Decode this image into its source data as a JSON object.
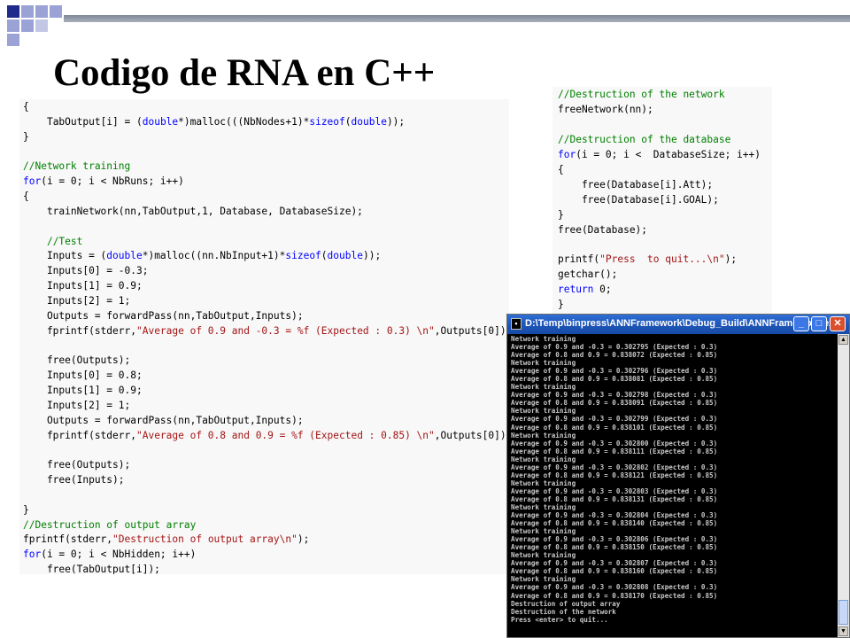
{
  "slide": {
    "title": "Codigo de RNA en C++",
    "accent_colors": [
      "#1f2b8c",
      "#9aa2d6"
    ]
  },
  "code_left": {
    "lines": [
      [
        {
          "t": "{"
        }
      ],
      [
        {
          "t": "    "
        },
        {
          "t": "TabOutput[i] = ("
        },
        {
          "t": "double",
          "c": "ty"
        },
        {
          "t": "*)malloc(((NbNodes+1)*"
        },
        {
          "t": "sizeof",
          "c": "kw"
        },
        {
          "t": "("
        },
        {
          "t": "double",
          "c": "ty"
        },
        {
          "t": "));"
        }
      ],
      [
        {
          "t": "}"
        }
      ],
      [
        {
          "t": ""
        }
      ],
      [
        {
          "t": "//Network training",
          "c": "cm"
        }
      ],
      [
        {
          "t": "for",
          "c": "kw"
        },
        {
          "t": "(i = 0; i < NbRuns; i++)"
        }
      ],
      [
        {
          "t": "{"
        }
      ],
      [
        {
          "t": "    trainNetwork(nn,TabOutput,1, Database, DatabaseSize);"
        }
      ],
      [
        {
          "t": ""
        }
      ],
      [
        {
          "t": "    "
        },
        {
          "t": "//Test",
          "c": "cm"
        }
      ],
      [
        {
          "t": "    Inputs = ("
        },
        {
          "t": "double",
          "c": "ty"
        },
        {
          "t": "*)malloc((nn.NbInput+1)*"
        },
        {
          "t": "sizeof",
          "c": "kw"
        },
        {
          "t": "("
        },
        {
          "t": "double",
          "c": "ty"
        },
        {
          "t": "));"
        }
      ],
      [
        {
          "t": "    Inputs[0] = -0.3;"
        }
      ],
      [
        {
          "t": "    Inputs[1] = 0.9;"
        }
      ],
      [
        {
          "t": "    Inputs[2] = 1;"
        }
      ],
      [
        {
          "t": "    Outputs = forwardPass(nn,TabOutput,Inputs);"
        }
      ],
      [
        {
          "t": "    fprintf(stderr,"
        },
        {
          "t": "\"Average of 0.9 and -0.3 = %f (Expected : 0.3) \\n\"",
          "c": "st"
        },
        {
          "t": ",Outputs[0]);"
        }
      ],
      [
        {
          "t": ""
        }
      ],
      [
        {
          "t": "    free(Outputs);"
        }
      ],
      [
        {
          "t": "    Inputs[0] = 0.8;"
        }
      ],
      [
        {
          "t": "    Inputs[1] = 0.9;"
        }
      ],
      [
        {
          "t": "    Inputs[2] = 1;"
        }
      ],
      [
        {
          "t": "    Outputs = forwardPass(nn,TabOutput,Inputs);"
        }
      ],
      [
        {
          "t": "    fprintf(stderr,"
        },
        {
          "t": "\"Average of 0.8 and 0.9 = %f (Expected : 0.85) \\n\"",
          "c": "st"
        },
        {
          "t": ",Outputs[0]);"
        }
      ],
      [
        {
          "t": ""
        }
      ],
      [
        {
          "t": "    free(Outputs);"
        }
      ],
      [
        {
          "t": "    free(Inputs);"
        }
      ],
      [
        {
          "t": ""
        }
      ],
      [
        {
          "t": "}"
        }
      ],
      [
        {
          "t": "//Destruction of output array",
          "c": "cm"
        }
      ],
      [
        {
          "t": "fprintf(stderr,"
        },
        {
          "t": "\"Destruction of output array\\n\"",
          "c": "st"
        },
        {
          "t": ");"
        }
      ],
      [
        {
          "t": "for",
          "c": "kw"
        },
        {
          "t": "(i = 0; i < NbHidden; i++)"
        }
      ],
      [
        {
          "t": "    free(TabOutput[i]);"
        }
      ]
    ]
  },
  "code_right": {
    "lines": [
      [
        {
          "t": "//Destruction of the network",
          "c": "cm"
        }
      ],
      [
        {
          "t": "freeNetwork(nn);"
        }
      ],
      [
        {
          "t": ""
        }
      ],
      [
        {
          "t": "//Destruction of the database",
          "c": "cm"
        }
      ],
      [
        {
          "t": "for",
          "c": "kw"
        },
        {
          "t": "(i = 0; i <  DatabaseSize; i++)"
        }
      ],
      [
        {
          "t": "{"
        }
      ],
      [
        {
          "t": "    free(Database[i].Att);"
        }
      ],
      [
        {
          "t": "    free(Database[i].GOAL);"
        }
      ],
      [
        {
          "t": "}"
        }
      ],
      [
        {
          "t": "free(Database);"
        }
      ],
      [
        {
          "t": ""
        }
      ],
      [
        {
          "t": "printf("
        },
        {
          "t": "\"Press  to quit...\\n\"",
          "c": "st"
        },
        {
          "t": ");"
        }
      ],
      [
        {
          "t": "getchar();"
        }
      ],
      [
        {
          "t": "return",
          "c": "kw"
        },
        {
          "t": " 0;"
        }
      ],
      [
        {
          "t": "}"
        }
      ]
    ]
  },
  "console": {
    "window_title": "D:\\Temp\\binpress\\ANNFramework\\Debug_Build\\ANNFramework.exe",
    "icon": "console-app-icon",
    "minimize_label": "_",
    "maximize_label": "□",
    "close_label": "✕",
    "lines": [
      "Network training",
      "Average of 0.9 and -0.3 = 0.302795 (Expected : 0.3)",
      "Average of 0.8 and 0.9 = 0.838072 (Expected : 0.85)",
      "Network training",
      "Average of 0.9 and -0.3 = 0.302796 (Expected : 0.3)",
      "Average of 0.8 and 0.9 = 0.838081 (Expected : 0.85)",
      "Network training",
      "Average of 0.9 and -0.3 = 0.302798 (Expected : 0.3)",
      "Average of 0.8 and 0.9 = 0.838091 (Expected : 0.85)",
      "Network training",
      "Average of 0.9 and -0.3 = 0.302799 (Expected : 0.3)",
      "Average of 0.8 and 0.9 = 0.838101 (Expected : 0.85)",
      "Network training",
      "Average of 0.9 and -0.3 = 0.302800 (Expected : 0.3)",
      "Average of 0.8 and 0.9 = 0.838111 (Expected : 0.85)",
      "Network training",
      "Average of 0.9 and -0.3 = 0.302802 (Expected : 0.3)",
      "Average of 0.8 and 0.9 = 0.838121 (Expected : 0.85)",
      "Network training",
      "Average of 0.9 and -0.3 = 0.302803 (Expected : 0.3)",
      "Average of 0.8 and 0.9 = 0.838131 (Expected : 0.85)",
      "Network training",
      "Average of 0.9 and -0.3 = 0.302804 (Expected : 0.3)",
      "Average of 0.8 and 0.9 = 0.838140 (Expected : 0.85)",
      "Network training",
      "Average of 0.9 and -0.3 = 0.302806 (Expected : 0.3)",
      "Average of 0.8 and 0.9 = 0.838150 (Expected : 0.85)",
      "Network training",
      "Average of 0.9 and -0.3 = 0.302807 (Expected : 0.3)",
      "Average of 0.8 and 0.9 = 0.838160 (Expected : 0.85)",
      "Network training",
      "Average of 0.9 and -0.3 = 0.302808 (Expected : 0.3)",
      "Average of 0.8 and 0.9 = 0.838170 (Expected : 0.85)",
      "Destruction of output array",
      "Destruction of the network",
      "Press <enter> to quit..."
    ]
  }
}
